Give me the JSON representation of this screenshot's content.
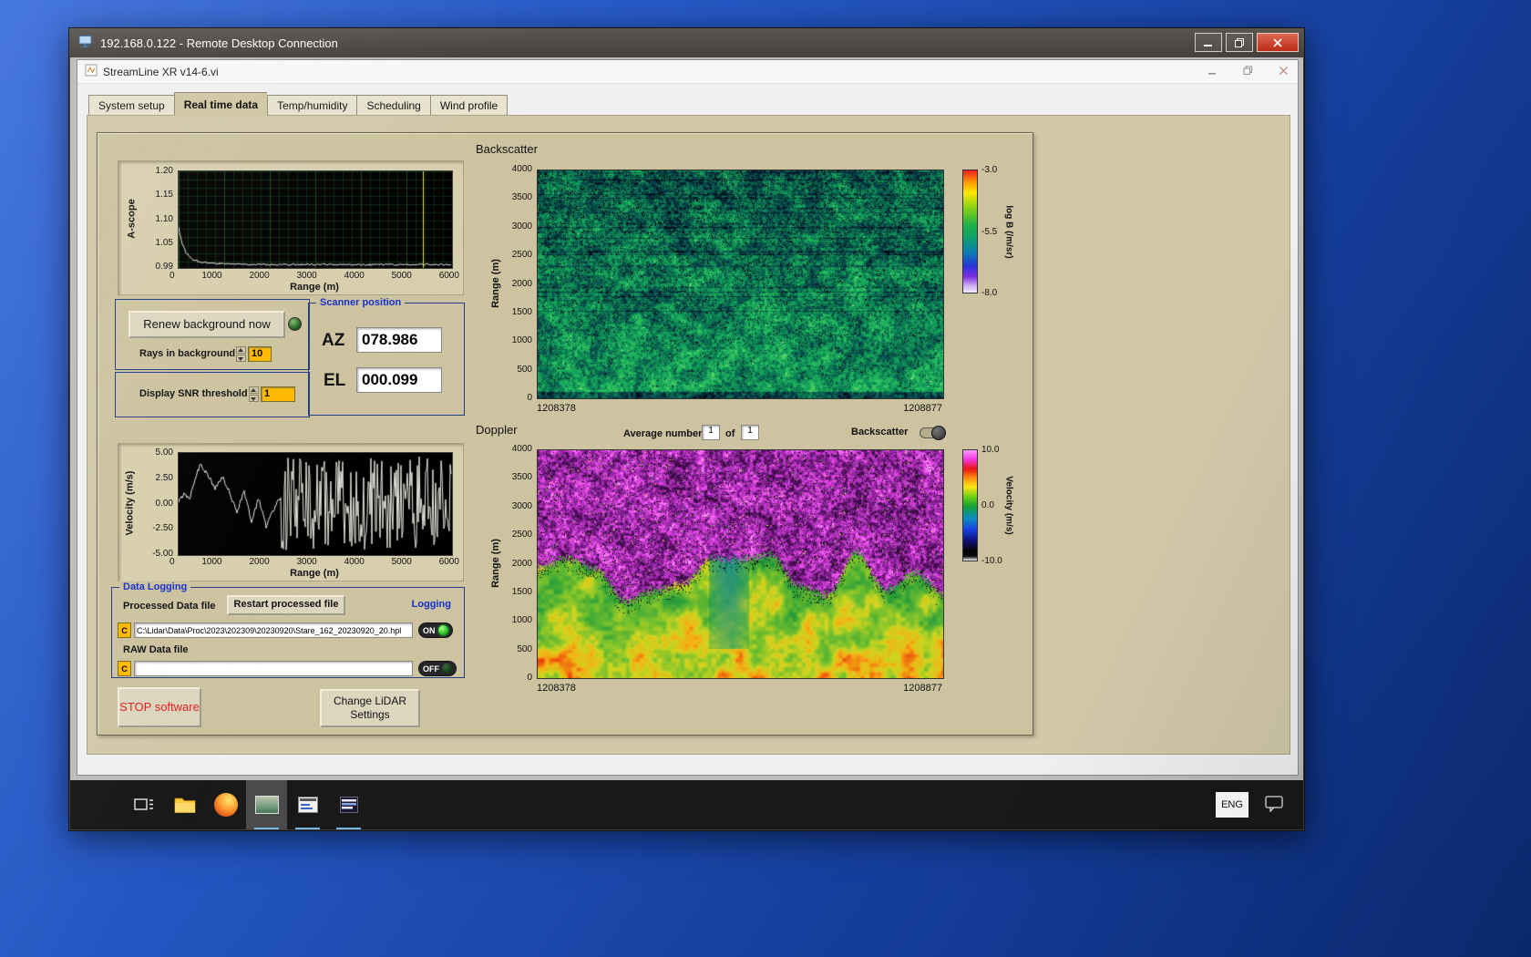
{
  "rdp": {
    "title": "192.168.0.122 - Remote Desktop Connection"
  },
  "app": {
    "title": "StreamLine XR v14-6.vi",
    "tabs": [
      "System setup",
      "Real time data",
      "Temp/humidity",
      "Scheduling",
      "Wind profile"
    ],
    "active_tab": "Real time data"
  },
  "ascope": {
    "ylabel": "A-scope",
    "xlabel": "Range (m)",
    "yticks": [
      "1.20",
      "1.15",
      "1.10",
      "1.05",
      "0.99"
    ],
    "xticks": [
      "0",
      "1000",
      "2000",
      "3000",
      "4000",
      "5000",
      "6000"
    ]
  },
  "background_controls": {
    "renew_button": "Renew background now",
    "rays_label": "Rays in background",
    "rays_value": "10",
    "snr_label": "Display SNR threshold",
    "snr_value": "1"
  },
  "scanner": {
    "title": "Scanner position",
    "az_label": "AZ",
    "az_value": "078.986",
    "el_label": "EL",
    "el_value": "000.099"
  },
  "velocity_plot": {
    "ylabel": "Velocity (m/s)",
    "xlabel": "Range (m)",
    "yticks": [
      "5.00",
      "2.50",
      "0.00",
      "-2.50",
      "-5.00"
    ],
    "xticks": [
      "0",
      "1000",
      "2000",
      "3000",
      "4000",
      "5000",
      "6000"
    ]
  },
  "data_logging": {
    "title": "Data Logging",
    "processed_label": "Processed Data file",
    "restart_button": "Restart processed file",
    "logging_label": "Logging",
    "drive_badge": "C",
    "processed_path": "C:\\Lidar\\Data\\Proc\\2023\\202309\\20230920\\Stare_162_20230920_20.hpl",
    "on_label": "ON",
    "raw_label": "RAW Data file",
    "raw_path": "",
    "off_label": "OFF"
  },
  "actions": {
    "stop_button": "STOP software",
    "change_button": "Change LiDAR Settings"
  },
  "backscatter": {
    "title": "Backscatter",
    "ylabel": "Range (m)",
    "yticks": [
      "4000",
      "3500",
      "3000",
      "2500",
      "2000",
      "1500",
      "1000",
      "500",
      "0"
    ],
    "x_start": "1208378",
    "x_end": "1208877",
    "colorbar_label": "log B (/m/sr)",
    "colorbar_ticks": [
      "-3.0",
      "-5.5",
      "-8.0"
    ]
  },
  "doppler": {
    "title": "Doppler",
    "avg_label": "Average number",
    "avg_value": "1",
    "of_label": "of",
    "of_count": "1",
    "toggle_label": "Backscatter",
    "ylabel": "Range (m)",
    "yticks": [
      "4000",
      "3500",
      "3000",
      "2500",
      "2000",
      "1500",
      "1000",
      "500",
      "0"
    ],
    "x_start": "1208378",
    "x_end": "1208877",
    "colorbar_label": "Velocity (m/s)",
    "colorbar_ticks": [
      "10.0",
      "0.0",
      "-10.0"
    ]
  },
  "taskbar": {
    "language": "ENG"
  },
  "render": {
    "plot_bg": "#000000",
    "grid_green": "#2a7a2a",
    "trace_white": "#e6e6de",
    "cursor_yellow": "#e8e83a",
    "panel_tan": "#cdc3a0",
    "group_border": "#233d84",
    "label_blue": "#1430c8",
    "value_orange": "#ffb902",
    "stop_red": "#e02020",
    "backscatter_ramp": [
      [
        0,
        "#00060e"
      ],
      [
        0.18,
        "#063f4c"
      ],
      [
        0.35,
        "#0b6e52"
      ],
      [
        0.55,
        "#14a35a"
      ],
      [
        0.72,
        "#2fc35f"
      ],
      [
        0.86,
        "#79da6d"
      ],
      [
        1,
        "#dff09a"
      ]
    ],
    "doppler_cold_ramp": [
      [
        0,
        "#0c0014"
      ],
      [
        0.28,
        "#581066"
      ],
      [
        0.5,
        "#a62cb4"
      ],
      [
        0.7,
        "#e748e7"
      ],
      [
        0.87,
        "#ff93ff"
      ],
      [
        1,
        "#fce8ff"
      ]
    ],
    "doppler_warm_ramp": [
      [
        0,
        "#0b6f3c"
      ],
      [
        0.3,
        "#2fa238"
      ],
      [
        0.5,
        "#7cc22c"
      ],
      [
        0.65,
        "#cfd41f"
      ],
      [
        0.8,
        "#f2b214"
      ],
      [
        0.91,
        "#f07010"
      ],
      [
        1,
        "#e02a0c"
      ]
    ],
    "teal": "#1f8f80",
    "backscatter_colorbar": "linear-gradient(180deg,#f02020 0%,#ff9c00 10%,#ffe800 18%,#8cd414 30%,#1fb048 45%,#0fa06e 55%,#0c7ab4 68%,#2636d8 78%,#7e2ee0 87%,#c9a8f0 94%,#f4eeff 100%)",
    "doppler_colorbar": "linear-gradient(180deg,#ff9cff 0%,#f23ae2 8%,#e81414 17%,#ff8c10 25%,#ffe414 33%,#62cc14 43%,#14a038 51%,#0e8cc4 62%,#1640e0 72%,#101078 82%,#050505 91%,#0a0a0a 96%,#f2f2f2 100%)"
  }
}
